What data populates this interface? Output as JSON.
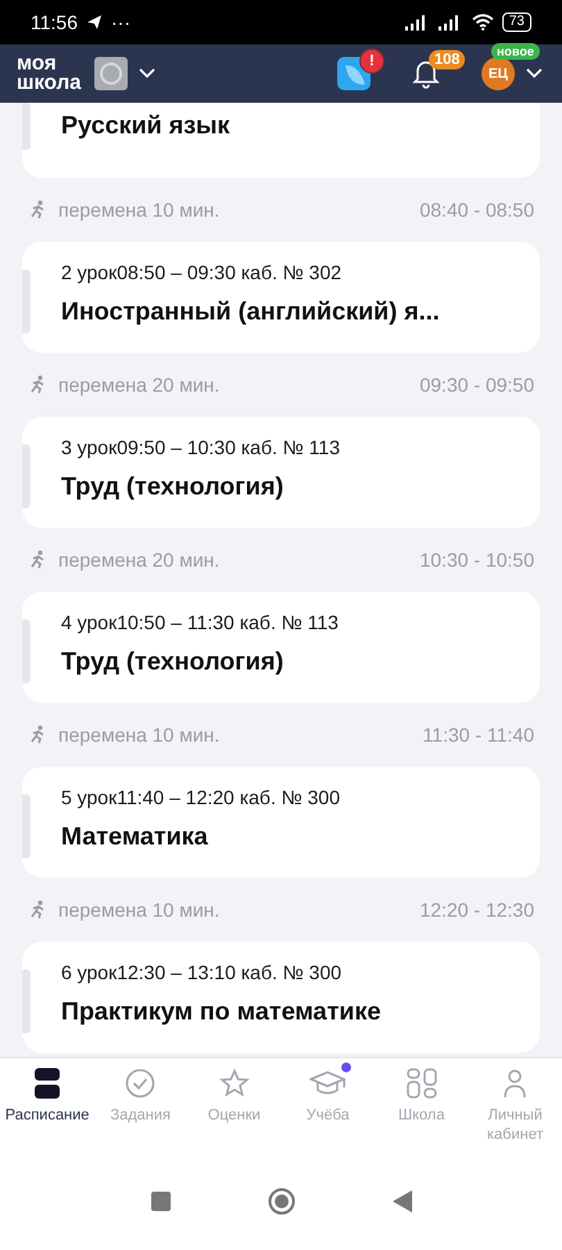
{
  "status_bar": {
    "time": "11:56",
    "dots": "···",
    "battery": "73"
  },
  "header": {
    "logo_line1": "моя",
    "logo_line2": "школа",
    "alert_badge": "!",
    "notifications": "108",
    "avatar": "ЕЦ",
    "new_badge": "новое"
  },
  "schedule": [
    {
      "kind": "lesson",
      "title": "Русский язык"
    },
    {
      "kind": "break",
      "label": "перемена 10 мин.",
      "time": "08:40 - 08:50"
    },
    {
      "kind": "lesson",
      "meta": "2 урок08:50 – 09:30 каб. № 302",
      "title": "Иностранный (английский) я..."
    },
    {
      "kind": "break",
      "label": "перемена 20 мин.",
      "time": "09:30 - 09:50"
    },
    {
      "kind": "lesson",
      "meta": "3 урок09:50 – 10:30 каб. № 113",
      "title": "Труд (технология)"
    },
    {
      "kind": "break",
      "label": "перемена 20 мин.",
      "time": "10:30 - 10:50"
    },
    {
      "kind": "lesson",
      "meta": "4 урок10:50 – 11:30 каб. № 113",
      "title": "Труд (технология)"
    },
    {
      "kind": "break",
      "label": "перемена 10 мин.",
      "time": "11:30 - 11:40"
    },
    {
      "kind": "lesson",
      "meta": "5 урок11:40 – 12:20 каб. № 300",
      "title": "Математика"
    },
    {
      "kind": "break",
      "label": "перемена 10 мин.",
      "time": "12:20 - 12:30"
    },
    {
      "kind": "lesson",
      "meta": "6 урок12:30 – 13:10 каб. № 300",
      "title": "Практикум по математике"
    }
  ],
  "nav": [
    {
      "kind": "schedule",
      "label": "Расписание",
      "selected": true,
      "dot": false
    },
    {
      "kind": "tasks",
      "label": "Задания",
      "selected": false,
      "dot": false
    },
    {
      "kind": "grades",
      "label": "Оценки",
      "selected": false,
      "dot": false
    },
    {
      "kind": "study",
      "label": "Учёба",
      "selected": false,
      "dot": true
    },
    {
      "kind": "school",
      "label": "Школа",
      "selected": false,
      "dot": false
    },
    {
      "kind": "profile",
      "label": "Личный кабинет",
      "selected": false,
      "dot": false
    }
  ]
}
